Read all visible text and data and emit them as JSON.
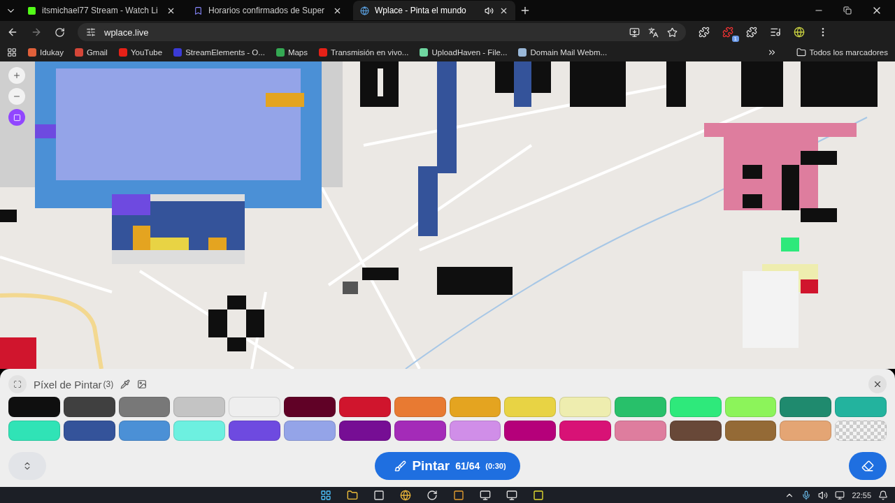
{
  "browser": {
    "tabs": [
      {
        "title": "itsmichael77 Stream - Watch Li",
        "selected": false,
        "audio": false
      },
      {
        "title": "Horarios confirmados de Super",
        "selected": false,
        "audio": false
      },
      {
        "title": "Wplace - Pinta el mundo",
        "selected": true,
        "audio": true
      }
    ],
    "address": "wplace.live",
    "bookmarks": [
      {
        "label": "Idukay",
        "color": "#e0603a"
      },
      {
        "label": "Gmail",
        "color": "#d44638"
      },
      {
        "label": "YouTube",
        "color": "#e62117"
      },
      {
        "label": "StreamElements - O...",
        "color": "#3b3bd6"
      },
      {
        "label": "Maps",
        "color": "#34a853"
      },
      {
        "label": "Transmisión en vivo...",
        "color": "#e62117"
      },
      {
        "label": "UploadHaven - File...",
        "color": "#6fd6a0"
      },
      {
        "label": "Domain Mail Webm...",
        "color": "#9ab8d8"
      }
    ],
    "all_bookmarks": "Todos los marcadores",
    "extension_badge": "1"
  },
  "panel": {
    "title": "Píxel de Pintar",
    "count": "(3)",
    "colors": [
      {
        "kind": "color",
        "color": "#0f0f0f"
      },
      {
        "kind": "color",
        "color": "#404040"
      },
      {
        "kind": "color",
        "color": "#787878"
      },
      {
        "kind": "color",
        "color": "#c4c4c4"
      },
      {
        "kind": "color",
        "color": "#eeeeee"
      },
      {
        "kind": "color",
        "color": "#600126"
      },
      {
        "kind": "color",
        "color": "#d0152d"
      },
      {
        "kind": "color",
        "color": "#e87a32"
      },
      {
        "kind": "color",
        "color": "#e4a420"
      },
      {
        "kind": "color",
        "color": "#e8d344"
      },
      {
        "kind": "color",
        "color": "#eeedaf"
      },
      {
        "kind": "color",
        "color": "#28c06a"
      },
      {
        "kind": "color",
        "color": "#2ee97b"
      },
      {
        "kind": "color",
        "color": "#8cf45a"
      },
      {
        "kind": "color",
        "color": "#1f8a6e"
      },
      {
        "kind": "color",
        "color": "#23b39e"
      },
      {
        "kind": "color",
        "color": "#30e3b6"
      },
      {
        "kind": "color",
        "color": "#34539a"
      },
      {
        "kind": "color",
        "color": "#4b90d6"
      },
      {
        "kind": "color",
        "color": "#6df0e0"
      },
      {
        "kind": "color",
        "color": "#6e4ae0"
      },
      {
        "kind": "color",
        "color": "#94a4e8"
      },
      {
        "kind": "color",
        "color": "#760e94"
      },
      {
        "kind": "color",
        "color": "#a42bb8"
      },
      {
        "kind": "color",
        "color": "#d08ee8"
      },
      {
        "kind": "color",
        "color": "#b5007a"
      },
      {
        "kind": "color",
        "color": "#d81276"
      },
      {
        "kind": "color",
        "color": "#de7d9e"
      },
      {
        "kind": "color",
        "color": "#684838"
      },
      {
        "kind": "color",
        "color": "#946a36"
      },
      {
        "kind": "color",
        "color": "#e4a574"
      },
      {
        "kind": "transparent"
      }
    ],
    "paint_button": {
      "label": "Pintar",
      "charges": "61/64",
      "timer": "(0:30)"
    }
  },
  "taskbar": {
    "time": "22:55"
  }
}
